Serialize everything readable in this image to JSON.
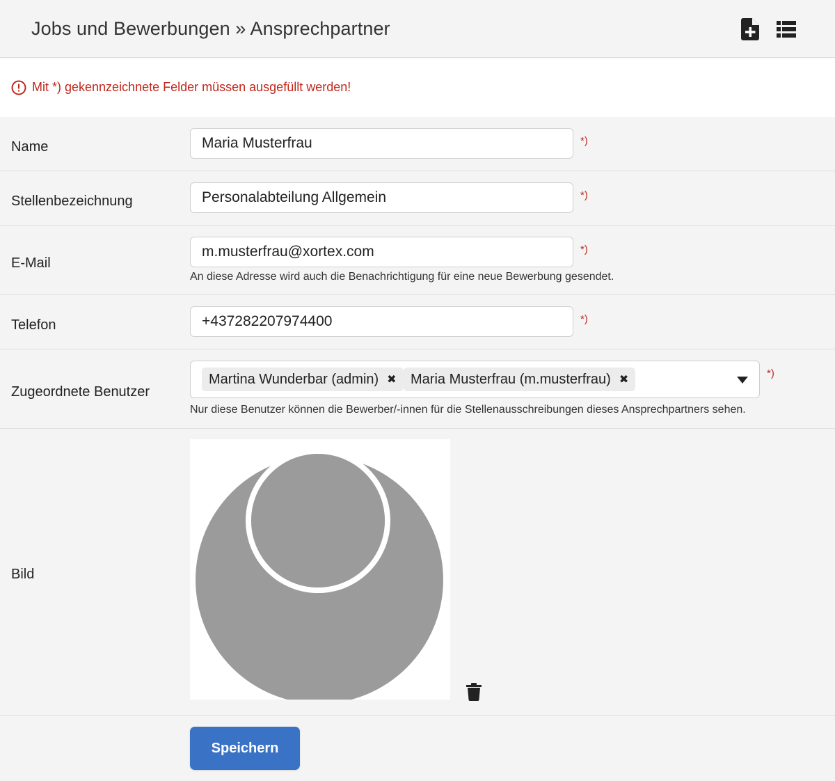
{
  "header": {
    "title": "Jobs und Bewerbungen » Ansprechpartner",
    "actions": [
      {
        "icon": "file-plus-icon"
      },
      {
        "icon": "list-icon"
      }
    ]
  },
  "notice": {
    "icon": "exclamation-circle-icon",
    "text": "Mit *) gekennzeichnete Felder müssen ausgefüllt werden!",
    "color": "#c0271b"
  },
  "form": {
    "required_mark": "*)",
    "name": {
      "label": "Name",
      "value": "Maria Musterfrau"
    },
    "job_title": {
      "label": "Stellenbezeichnung",
      "value": "Personalabteilung Allgemein"
    },
    "email": {
      "label": "E-Mail",
      "value": "m.musterfrau@xortex.com",
      "hint": "An diese Adresse wird auch die Benachrichtigung für eine neue Bewerbung gesendet."
    },
    "phone": {
      "label": "Telefon",
      "value": "+437282207974400"
    },
    "assigned_users": {
      "label": "Zugeordnete Benutzer",
      "selected": [
        {
          "label": "Martina Wunderbar (admin)",
          "remove_glyph": "✖"
        },
        {
          "label": "Maria Musterfrau (m.musterfrau)",
          "remove_glyph": "✖"
        }
      ],
      "hint": "Nur diese Benutzer können die Bewerber/-innen für die Stellenausschreibungen dieses Ansprechpartners sehen."
    },
    "image": {
      "label": "Bild",
      "placeholder_icon": "person-silhouette-icon",
      "delete_icon": "trash-icon"
    },
    "save_label": "Speichern"
  },
  "colors": {
    "accent": "#3a73c6",
    "error": "#c0271b",
    "background": "#f4f4f4"
  }
}
